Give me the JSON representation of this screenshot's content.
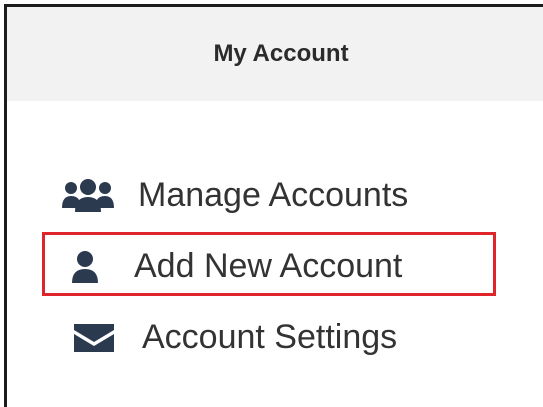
{
  "panel": {
    "title": "My Account"
  },
  "menu": {
    "items": [
      {
        "label": "Manage Accounts",
        "icon": "users-icon"
      },
      {
        "label": "Add New Account",
        "icon": "user-icon"
      },
      {
        "label": "Account Settings",
        "icon": "envelope-icon"
      }
    ]
  },
  "colors": {
    "highlight_border": "#e0242b",
    "header_bg": "#f2f2f2",
    "icon": "#2b3a4e",
    "text": "#333333"
  }
}
